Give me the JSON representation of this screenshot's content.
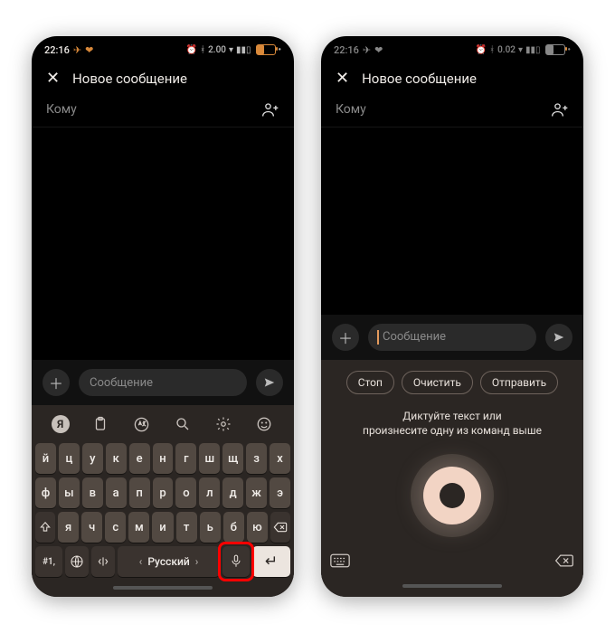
{
  "status": {
    "time": "22:16",
    "net_label_a": "2.00",
    "net_unit_a": "KB/S",
    "net_label_b": "0.02",
    "battery_text": "48"
  },
  "header": {
    "title": "Новое сообщение"
  },
  "recipient": {
    "label": "Кому"
  },
  "compose": {
    "placeholder": "Сообщение"
  },
  "keyboard": {
    "row1": [
      "й",
      "ц",
      "у",
      "к",
      "е",
      "н",
      "г",
      "ш",
      "щ",
      "з",
      "х"
    ],
    "row2": [
      "ф",
      "ы",
      "в",
      "а",
      "п",
      "р",
      "о",
      "л",
      "д",
      "ж",
      "э"
    ],
    "row3": [
      "я",
      "ч",
      "с",
      "м",
      "и",
      "т",
      "ь",
      "б",
      "ю"
    ],
    "symbols_label": "#1,",
    "space_label": "Русский"
  },
  "voice": {
    "chips": [
      "Стоп",
      "Очистить",
      "Отправить"
    ],
    "hint_line1": "Диктуйте текст или",
    "hint_line2": "произнесите одну из команд выше"
  }
}
